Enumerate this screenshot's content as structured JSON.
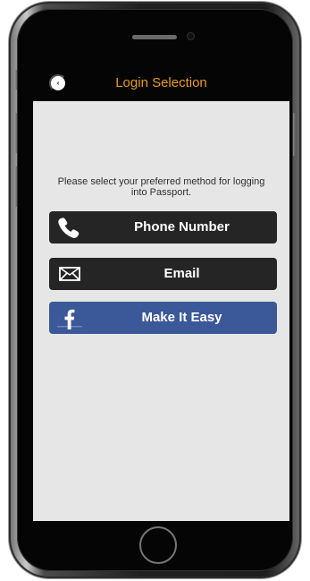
{
  "device": {
    "frame_color": "#1f1f1f"
  },
  "screen": {
    "background": "#e6e6e6",
    "nav": {
      "title": "Login Selection",
      "title_color": "#e89a22",
      "back_icon": "chevron-left-icon"
    },
    "instruction": "Please select your preferred method for logging into Passport.",
    "options": [
      {
        "label": "Phone Number",
        "icon": "phone-icon",
        "background": "#252525"
      },
      {
        "label": "Email",
        "icon": "envelope-icon",
        "background": "#252525"
      },
      {
        "label": "Make It Easy",
        "icon": "facebook-icon",
        "background": "#3b5899"
      }
    ]
  }
}
